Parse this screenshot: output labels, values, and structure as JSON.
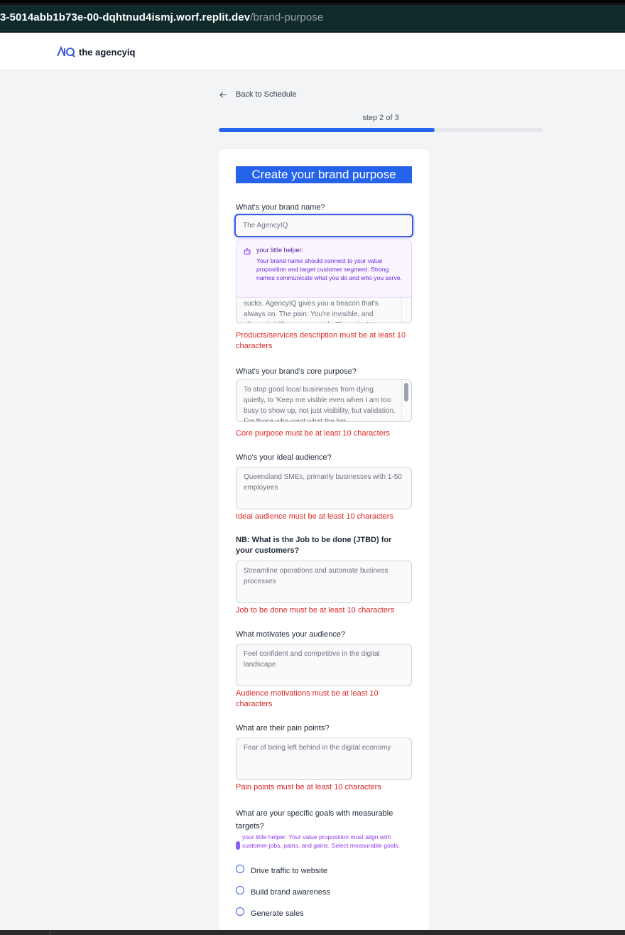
{
  "browser": {
    "url_host": "3-5014abb1b73e-00-dqhtnud4ismj.worf.replit.dev",
    "url_path": "/brand-purpose"
  },
  "header": {
    "logo_mark": "AIQ",
    "logo_text": "the agencyiq"
  },
  "nav": {
    "back_label": "Back to Schedule",
    "step_text": "step 2 of 3",
    "progress_fraction": 0.667
  },
  "form": {
    "title": "Create your brand purpose",
    "brand_name": {
      "label": "What's your brand name?",
      "value": "The AgencyIQ"
    },
    "helper": {
      "title": "your little helper:",
      "text": "Your brand name should connect to your value proposition and target customer segment. Strong names communicate what you do and who you serve."
    },
    "products": {
      "value": "sucks. AgencyIQ gives you a beacon that's always on. The pain: You're invisible, and silence is killing your growth. The gain: You",
      "error": "Products/services description must be at least 10 characters"
    },
    "core_purpose": {
      "label": "What's your brand's core purpose?",
      "value": "To stop good local businesses from dying quietly, to 'Keep me visible even when I am too busy to show up, not just visibility, but validation. For those who want what the big",
      "error": "Core purpose must be at least 10 characters"
    },
    "audience": {
      "label": "Who's your ideal audience?",
      "placeholder": "Queensland SMEs, primarily businesses with 1-50 employees",
      "error": "Ideal audience must be at least 10 characters"
    },
    "jtbd": {
      "label": "NB: What is the Job to be done (JTBD) for your customers?",
      "placeholder": "Streamline operations and automate business processes",
      "error": "Job to be done must be at least 10 characters"
    },
    "motivations": {
      "label": "What motivates your audience?",
      "placeholder": "Feel confident and competitive in the digital landscape",
      "error": "Audience motivations must be at least 10 characters"
    },
    "pain_points": {
      "label": "What are their pain points?",
      "placeholder": "Fear of being left behind in the digital economy",
      "error": "Pain points must be at least 10 characters"
    },
    "goals": {
      "label": "What are your specific goals with measurable targets?",
      "tip": "your little helper: Your value proposition must align with customer jobs, pains, and gains. Select measurable goals.",
      "options": [
        "Drive traffic to website",
        "Build brand awareness",
        "Generate sales"
      ]
    }
  },
  "colors": {
    "primary": "#2563eb",
    "error": "#dc2626",
    "helper_bg": "#faf5ff",
    "helper_text": "#6d28d9"
  }
}
